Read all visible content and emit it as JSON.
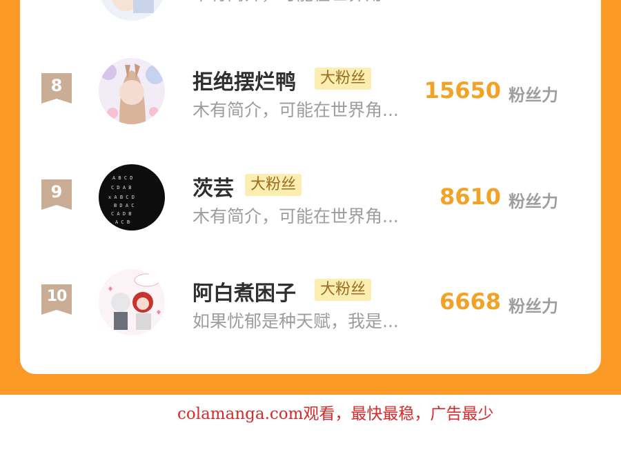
{
  "ranking": {
    "partial_row": {
      "desc": "木有简介，可能在世界角..."
    },
    "rows": [
      {
        "rank": "8",
        "name": "拒绝摆烂鸭",
        "badge": "大粉丝",
        "desc": "木有简介，可能在世界角...",
        "score": "15650",
        "unit": "粉丝力"
      },
      {
        "rank": "9",
        "name": "茨芸",
        "badge": "大粉丝",
        "desc": "木有简介，可能在世界角...",
        "score": "8610",
        "unit": "粉丝力"
      },
      {
        "rank": "10",
        "name": "阿白煮困子",
        "badge": "大粉丝",
        "desc": "如果忧郁是种天赋，我是...",
        "score": "6668",
        "unit": "粉丝力"
      }
    ]
  },
  "watermark": {
    "text": "colamanga.com观看，最快最稳，广告最少"
  },
  "colors": {
    "accent": "#fb9a27",
    "score": "#f2a227",
    "badge_bg": "#fbeeb0",
    "rank_bg": "#c9ad94",
    "watermark": "#d62a2a"
  }
}
